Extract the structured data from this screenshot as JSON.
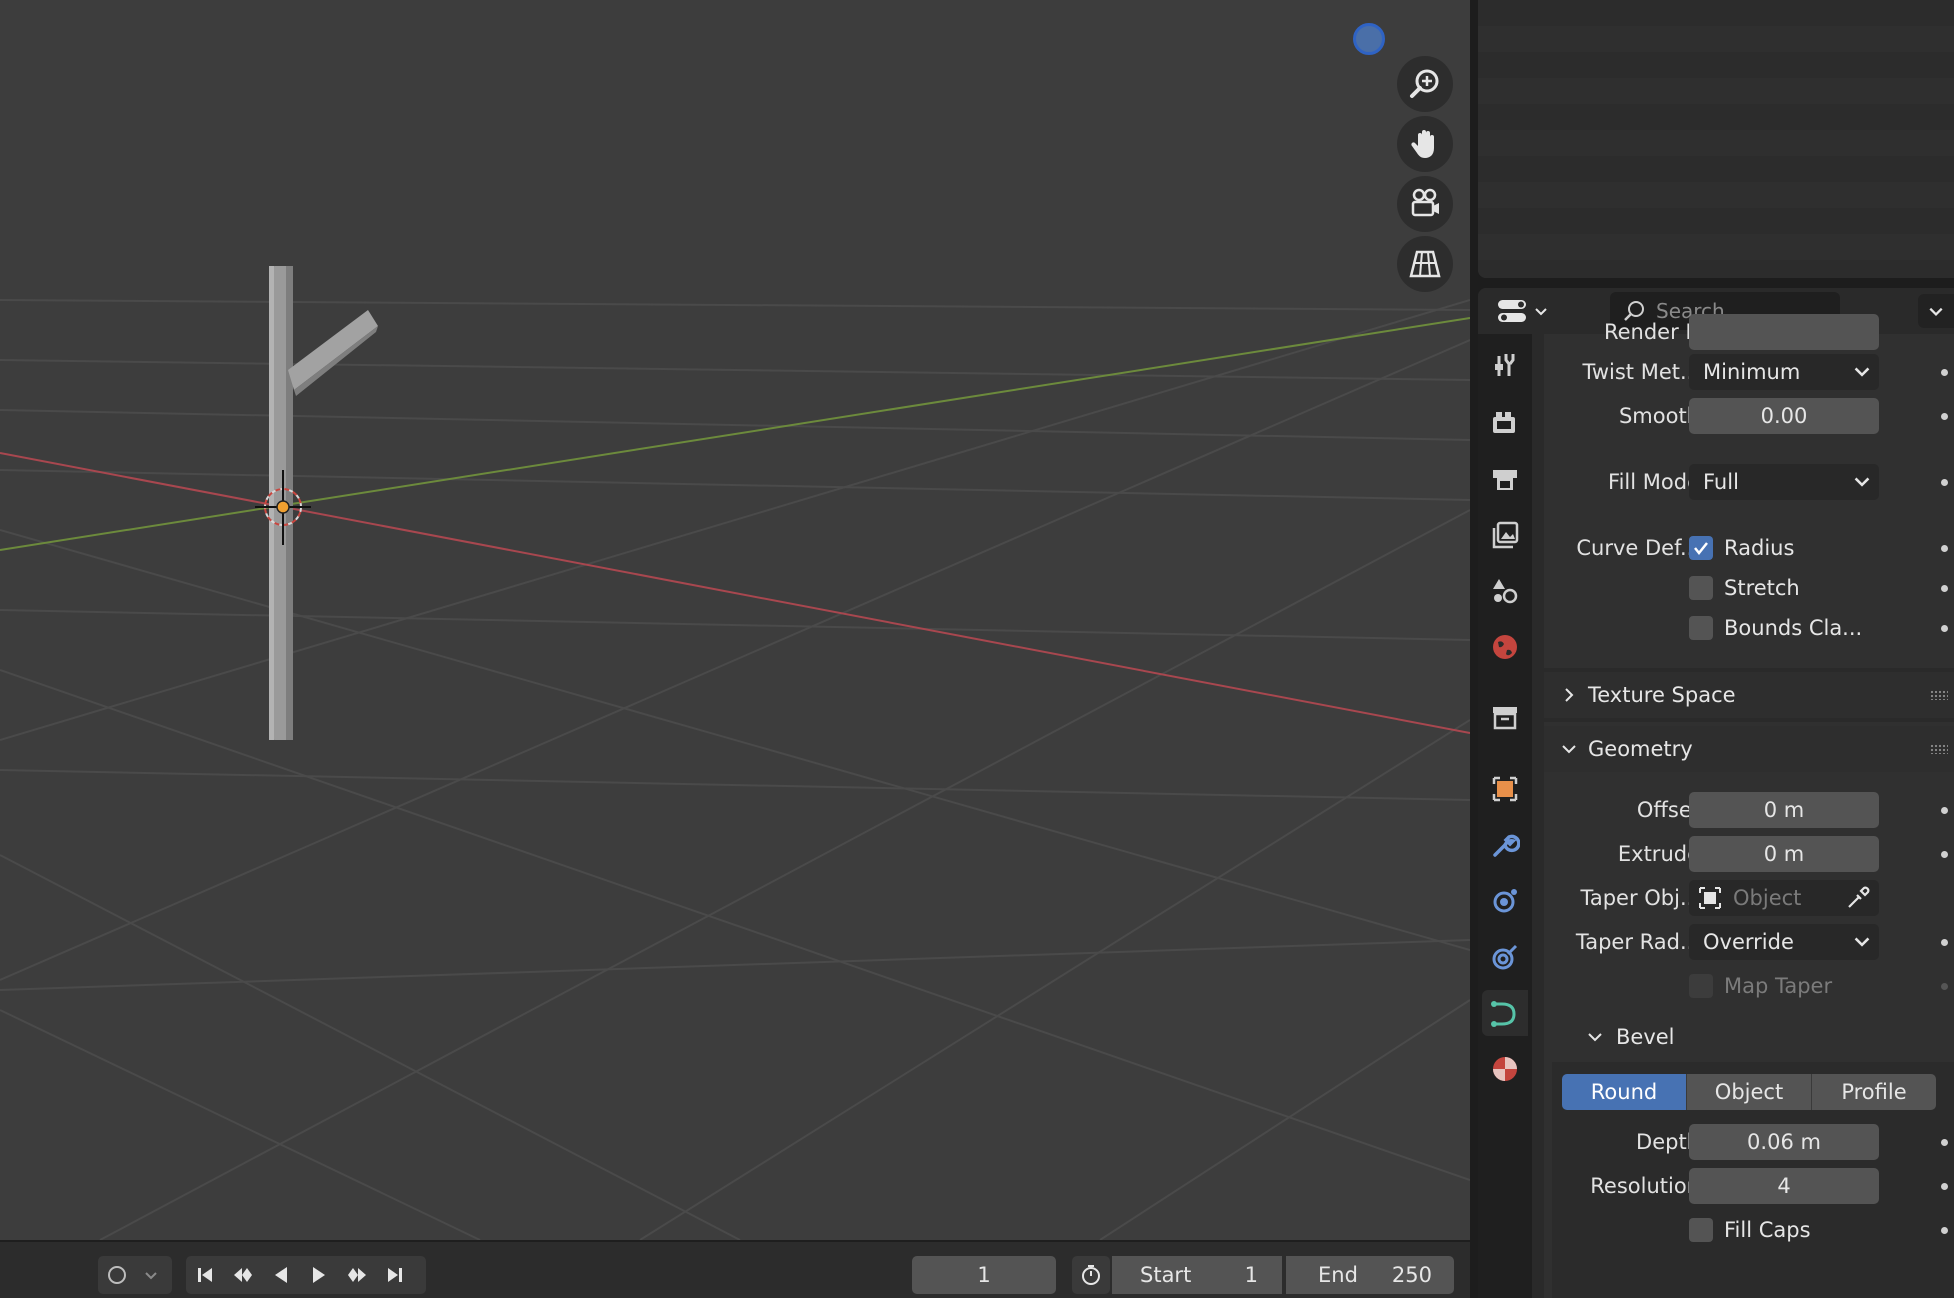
{
  "timeline": {
    "current_frame": "1",
    "start_label": "Start",
    "start_value": "1",
    "end_label": "End",
    "end_value": "250"
  },
  "properties": {
    "search_placeholder": "Search",
    "clipped_row_label": "Render R",
    "twist": {
      "label": "Twist Met...",
      "value": "Minimum"
    },
    "smooth": {
      "label": "Smooth",
      "value": "0.00"
    },
    "fill_mode": {
      "label": "Fill Mode",
      "value": "Full"
    },
    "curve_deform": {
      "label": "Curve Def...",
      "radius": {
        "label": "Radius",
        "checked": true
      },
      "stretch": {
        "label": "Stretch",
        "checked": false
      },
      "bounds": {
        "label": "Bounds Cla...",
        "checked": false
      }
    },
    "texture_space": {
      "title": "Texture Space",
      "collapsed": true
    },
    "geometry": {
      "title": "Geometry",
      "offset": {
        "label": "Offset",
        "value": "0 m"
      },
      "extrude": {
        "label": "Extrude",
        "value": "0 m"
      },
      "taper_object": {
        "label": "Taper Obj...",
        "placeholder": "Object"
      },
      "taper_radius": {
        "label": "Taper Rad...",
        "value": "Override"
      },
      "map_taper": {
        "label": "Map Taper",
        "checked": false
      }
    },
    "bevel": {
      "title": "Bevel",
      "modes": [
        "Round",
        "Object",
        "Profile"
      ],
      "selected_mode": "Round",
      "depth": {
        "label": "Depth",
        "value": "0.06 m"
      },
      "resolution": {
        "label": "Resolution",
        "value": "4"
      },
      "fill_caps": {
        "label": "Fill Caps",
        "checked": false
      }
    }
  },
  "colors": {
    "accent": "#4772b3",
    "viewport_bg": "#3d3d3d",
    "x_axis": "#a8474f",
    "y_axis": "#6c8a3c"
  }
}
